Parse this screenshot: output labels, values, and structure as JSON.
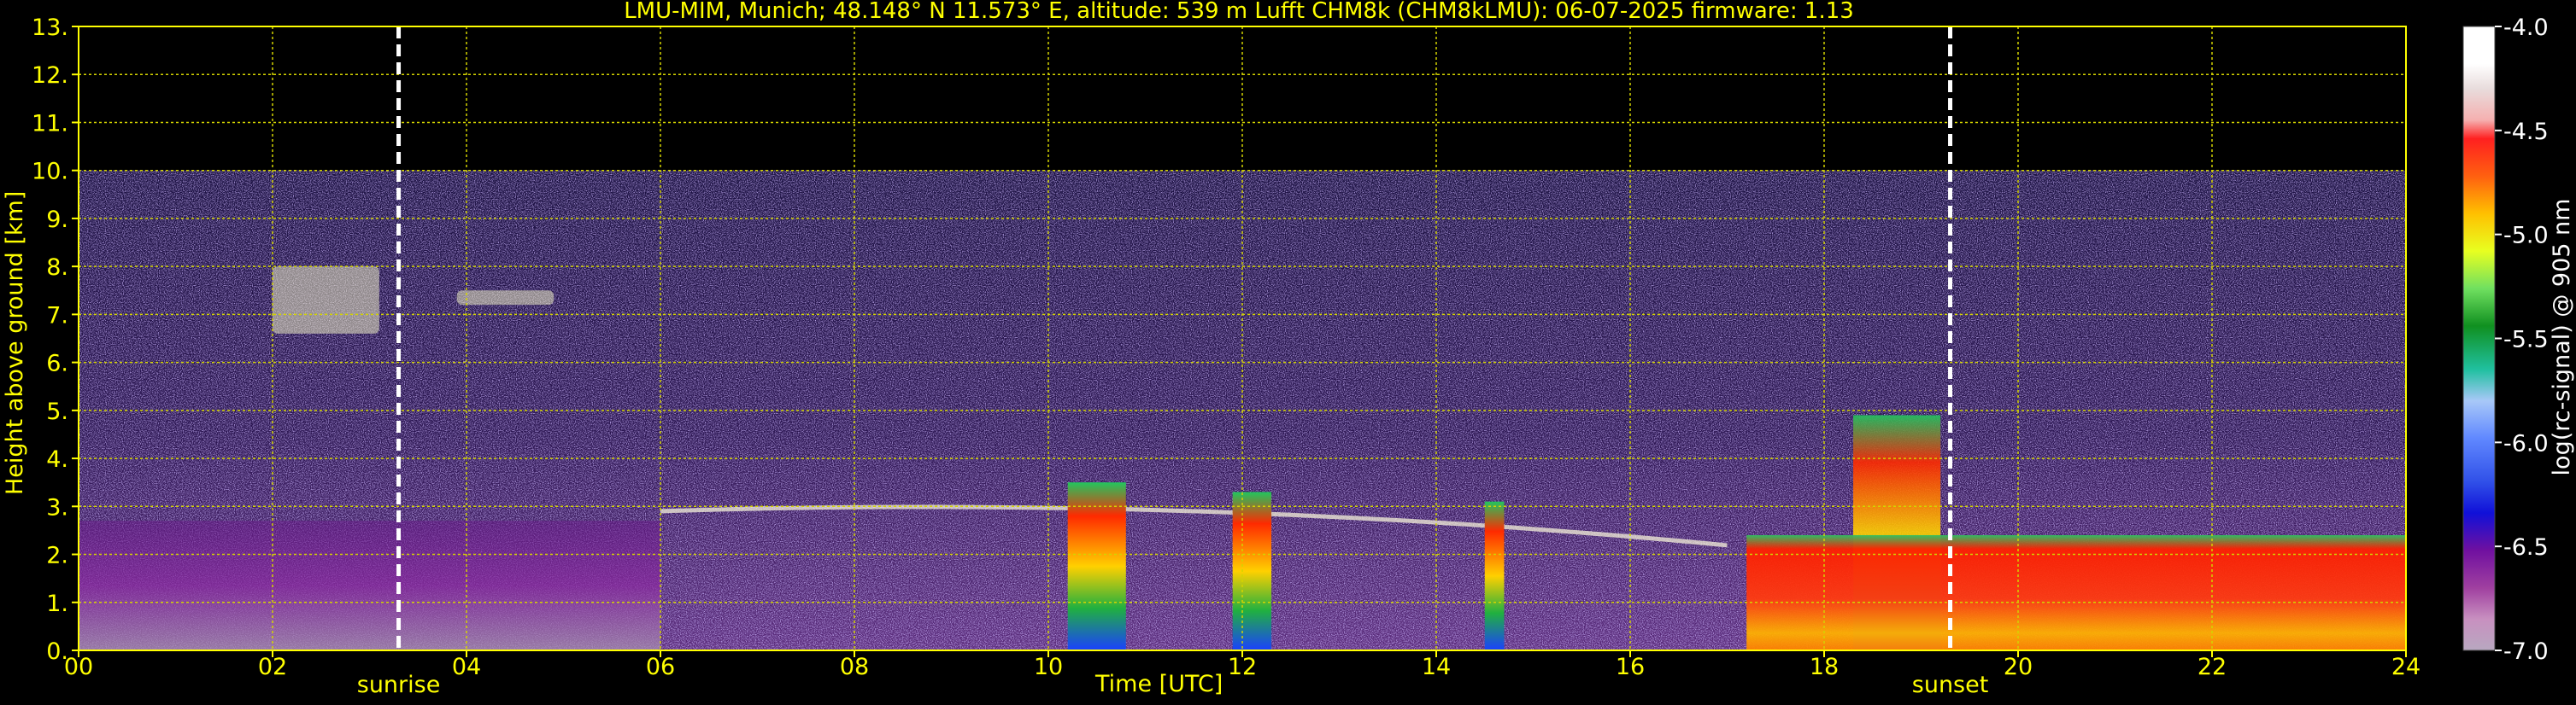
{
  "chart_data": {
    "type": "heatmap",
    "title": "LMU-MIM, Munich; 48.148° N 11.573° E, altitude: 539 m    Lufft CHM8k (CHM8kLMU): 06-07-2025    firmware: 1.13",
    "xlabel": "Time [UTC]",
    "ylabel": "Height above ground [km]",
    "xlim": [
      0,
      24
    ],
    "ylim": [
      0,
      13
    ],
    "xticks": [
      "00",
      "02",
      "04",
      "06",
      "08",
      "10",
      "12",
      "14",
      "16",
      "18",
      "20",
      "22",
      "24"
    ],
    "yticks": [
      "0.",
      "1.",
      "2.",
      "3.",
      "4.",
      "5.",
      "6.",
      "7.",
      "8.",
      "9.",
      "10.",
      "11.",
      "12.",
      "13."
    ],
    "grid": true,
    "signal_top_km": 10,
    "annotations": [
      {
        "text": "sunrise",
        "x": 3.3
      },
      {
        "text": "sunset",
        "x": 19.3
      }
    ],
    "colorbar": {
      "label": "log(rc-signal) @ 905 nm",
      "range": [
        -7.0,
        -4.0
      ],
      "ticks": [
        "-4.0",
        "-4.5",
        "-5.0",
        "-5.5",
        "-6.0",
        "-6.5",
        "-7.0"
      ]
    },
    "features": [
      {
        "name": "boundary layer aerosol",
        "t_start": 0,
        "t_end": 6,
        "top_km": 2.7
      },
      {
        "name": "cirrus",
        "t_start": 2.0,
        "t_end": 3.1,
        "base_km": 6.6,
        "top_km": 8.0
      },
      {
        "name": "cirrus",
        "t_start": 3.9,
        "t_end": 4.9,
        "base_km": 7.2,
        "top_km": 7.5
      },
      {
        "name": "cloud layer",
        "t_start": 6,
        "t_end": 17,
        "height_km": 2.9
      },
      {
        "name": "precipitation column",
        "t_start": 10.2,
        "t_end": 10.8,
        "top_km": 3.5
      },
      {
        "name": "precipitation column",
        "t_start": 11.9,
        "t_end": 12.3,
        "top_km": 3.3
      },
      {
        "name": "precipitation column",
        "t_start": 14.5,
        "t_end": 14.7,
        "top_km": 3.1
      },
      {
        "name": "convective cloud",
        "t_start": 18.3,
        "t_end": 19.2,
        "top_km": 4.9
      },
      {
        "name": "evening boundary layer",
        "t_start": 17.2,
        "t_end": 24,
        "top_km": 2.4
      }
    ]
  }
}
